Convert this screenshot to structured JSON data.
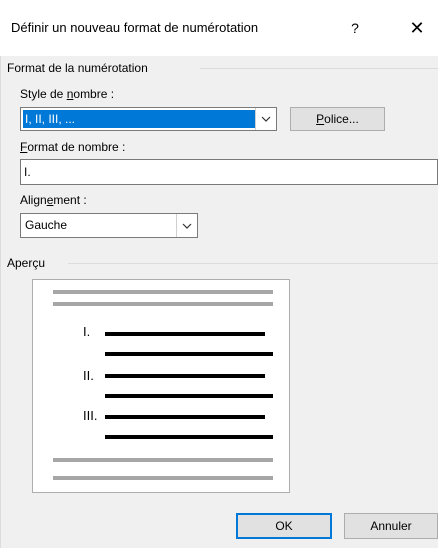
{
  "dialog": {
    "title": "Définir un nouveau format de numérotation",
    "help_label": "?",
    "close_label": "✕"
  },
  "format_group": {
    "label": "Format de la numérotation",
    "style_label_pre": "Style de ",
    "style_label_key": "n",
    "style_label_post": "ombre :",
    "style_value": "I, II, III, ...",
    "font_button_key": "P",
    "font_button_post": "olice...",
    "format_label_key": "F",
    "format_label_post": "ormat de nombre :",
    "format_value": "I.",
    "alignment_label_pre": "Align",
    "alignment_label_key": "e",
    "alignment_label_post": "ment :",
    "alignment_value": "Gauche"
  },
  "preview_group": {
    "label": "Aperçu",
    "numbers": [
      "I.",
      "II.",
      "III."
    ]
  },
  "buttons": {
    "ok": "OK",
    "cancel": "Annuler"
  },
  "colors": {
    "selection": "#0078d7",
    "default_button_border": "#0078d7",
    "preview_gray_bar": "#a6a6a6",
    "preview_black_bar": "#000000"
  },
  "icons": {
    "dropdown": "chevron-down-icon",
    "close": "close-icon",
    "help": "help-icon"
  }
}
